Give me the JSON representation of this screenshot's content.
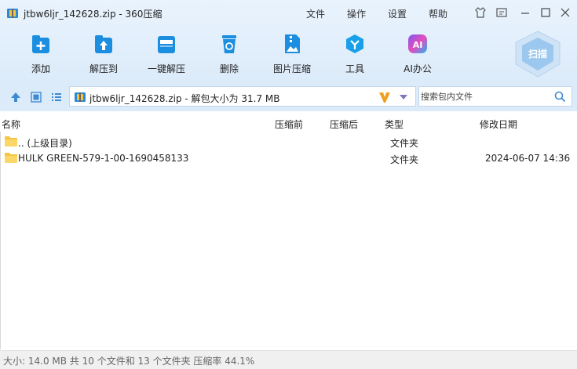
{
  "window": {
    "title": "jtbw6ljr_142628.zip - 360压缩",
    "menus": [
      "文件",
      "操作",
      "设置",
      "帮助"
    ]
  },
  "toolbar": {
    "items": [
      {
        "label": "添加",
        "icon": "add-icon"
      },
      {
        "label": "解压到",
        "icon": "extract-to-icon"
      },
      {
        "label": "一键解压",
        "icon": "one-click-extract-icon"
      },
      {
        "label": "删除",
        "icon": "delete-icon"
      },
      {
        "label": "图片压缩",
        "icon": "image-compress-icon"
      },
      {
        "label": "工具",
        "icon": "tools-icon"
      },
      {
        "label": "AI办公",
        "icon": "ai-office-icon"
      }
    ],
    "scan_label": "扫描"
  },
  "address": {
    "text": "jtbw6ljr_142628.zip - 解包大小为 31.7 MB"
  },
  "search": {
    "placeholder": "搜索包内文件"
  },
  "columns": {
    "name": "名称",
    "compressed": "压缩前",
    "original": "压缩后",
    "type": "类型",
    "modified": "修改日期"
  },
  "files": [
    {
      "name": ".. (上级目录)",
      "type": "文件夹",
      "modified": ""
    },
    {
      "name": "HULK GREEN-579-1-00-1690458133",
      "type": "文件夹",
      "modified": "2024-06-07 14:36"
    }
  ],
  "status": {
    "text": "大小: 14.0 MB 共 10 个文件和 13 个文件夹 压缩率 44.1%"
  },
  "colors": {
    "accent": "#1c8ee0",
    "toolbar_bg": "#e3effb",
    "folder": "#f5c542"
  }
}
